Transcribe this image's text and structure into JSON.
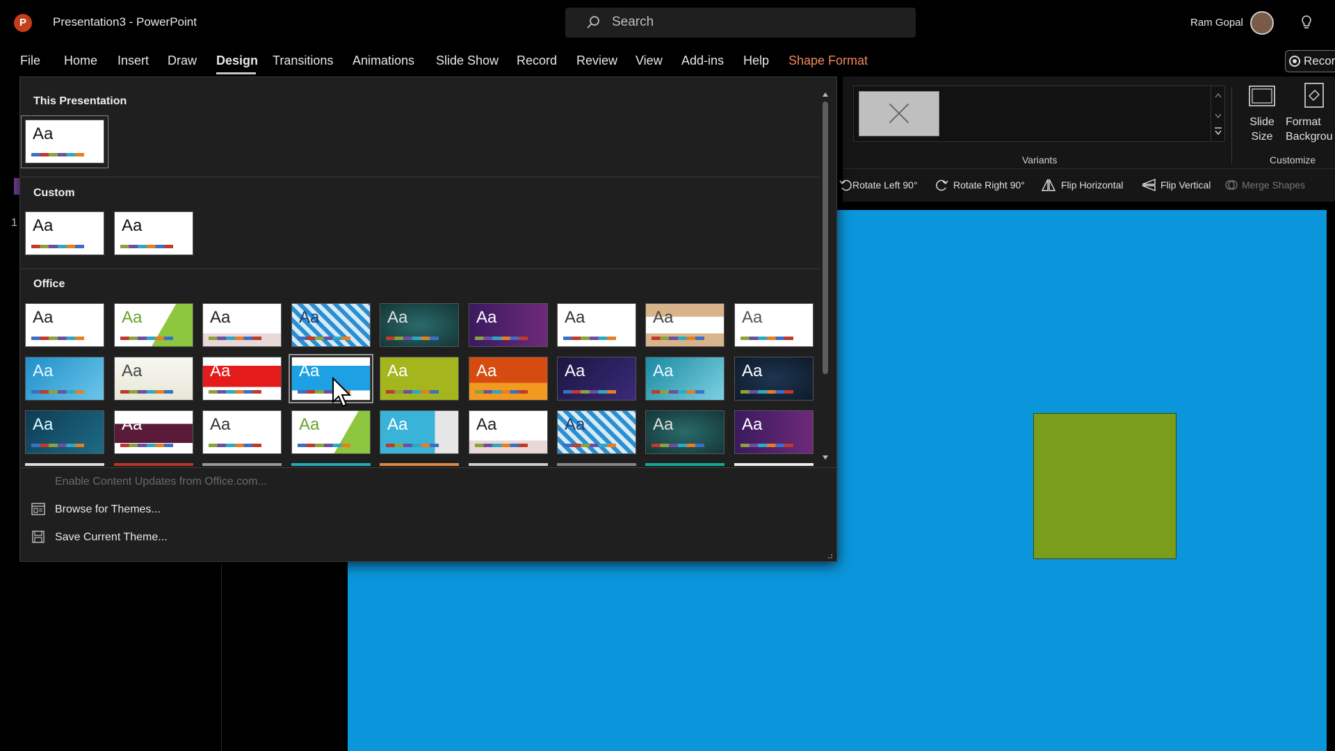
{
  "titlebar": {
    "app_logo": "P",
    "doc_title": "Presentation3  -  PowerPoint",
    "search_placeholder": "Search",
    "user_name": "Ram Gopal"
  },
  "menu": {
    "items": [
      "File",
      "Home",
      "Insert",
      "Draw",
      "Design",
      "Transitions",
      "Animations",
      "Slide Show",
      "Record",
      "Review",
      "View",
      "Add-ins",
      "Help",
      "Shape Format"
    ],
    "active": "Design",
    "contextual": "Shape Format",
    "record_label": "Recor"
  },
  "ribbon": {
    "variants_label": "Variants",
    "slide_size_label": "Slide Size",
    "format_background_label": "Format Backgrou",
    "customize_label": "Customize",
    "arrange": {
      "rotate_left": "Rotate Left 90°",
      "rotate_right": "Rotate Right 90°",
      "flip_horizontal": "Flip Horizontal",
      "flip_vertical": "Flip Vertical",
      "merge_shapes": "Merge Shapes"
    }
  },
  "slide_pane": {
    "slide_number": "1"
  },
  "theme_panel": {
    "section_this": "This Presentation",
    "section_custom": "Custom",
    "section_office": "Office",
    "thumb_text": "Aa",
    "enable_updates": "Enable Content Updates from Office.com...",
    "browse_themes": "Browse for Themes...",
    "save_theme": "Save Current Theme..."
  },
  "colors": {
    "slide_bg": "#0b95db",
    "shape_fill": "#7a9e1b",
    "shape_format_accent": "#f08a5d",
    "app_logo": "#c43e1c"
  },
  "icons": [
    "search-icon",
    "lightbulb-icon",
    "record-icon",
    "slide-size-icon",
    "format-background-icon",
    "rotate-left-icon",
    "rotate-right-icon",
    "flip-horizontal-icon",
    "flip-vertical-icon",
    "merge-shapes-icon",
    "browse-themes-icon",
    "save-theme-icon",
    "mouse-cursor-icon"
  ]
}
